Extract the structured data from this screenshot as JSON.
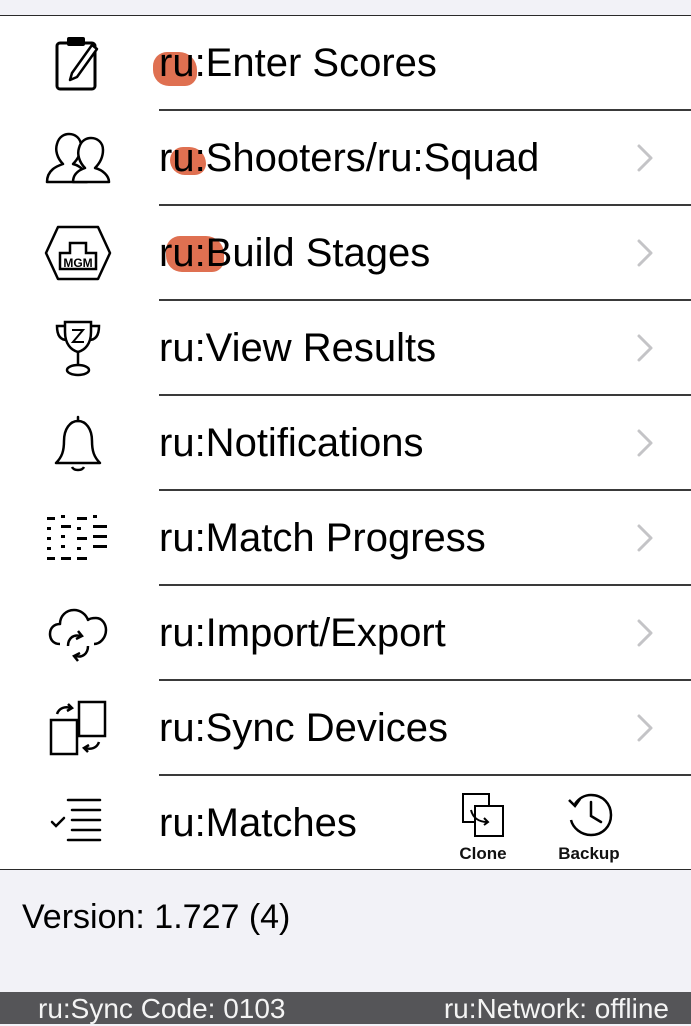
{
  "menu": {
    "items": [
      {
        "label": "ru:Enter Scores",
        "icon": "clipboard-edit-icon",
        "has_chevron": false
      },
      {
        "label": "ru:Shooters/ru:Squad",
        "icon": "people-icon",
        "has_chevron": true
      },
      {
        "label": "ru:Build Stages",
        "icon": "mgm-target-icon",
        "has_chevron": true
      },
      {
        "label": "ru:View Results",
        "icon": "trophy-icon",
        "has_chevron": true
      },
      {
        "label": "ru:Notifications",
        "icon": "bell-icon",
        "has_chevron": true
      },
      {
        "label": "ru:Match Progress",
        "icon": "progress-grid-icon",
        "has_chevron": true
      },
      {
        "label": "ru:Import/Export",
        "icon": "cloud-sync-icon",
        "has_chevron": true
      },
      {
        "label": "ru:Sync Devices",
        "icon": "devices-sync-icon",
        "has_chevron": true
      },
      {
        "label": "ru:Matches",
        "icon": "checklist-icon",
        "has_chevron": false
      }
    ],
    "clone_label": "Clone",
    "backup_label": "Backup"
  },
  "footer": {
    "version": "Version: 1.727 (4)"
  },
  "status": {
    "sync_code": "ru:Sync Code: 0103",
    "network": "ru:Network: offline"
  },
  "colors": {
    "background": "#f2f2f7",
    "list": "#ffffff",
    "status_bar": "#555558",
    "chevron": "#c4c4c7",
    "highlight_mark": "#d64820"
  }
}
